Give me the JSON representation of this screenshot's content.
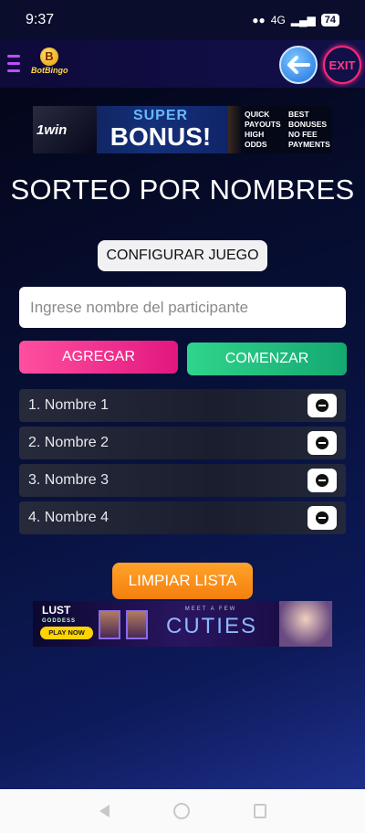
{
  "status_bar": {
    "time": "9:37",
    "network_label": "4G",
    "battery": "74"
  },
  "header": {
    "logo_letter": "B",
    "logo_text": "BotBingo",
    "exit_label": "EXIT"
  },
  "ad_top": {
    "brand": "1win",
    "headline_small": "SUPER",
    "headline_big": "BONUS!",
    "col1": [
      "QUICK",
      "PAYOUTS",
      "HIGH",
      "ODDS"
    ],
    "col2": [
      "BEST",
      "BONUSES",
      "NO FEE",
      "PAYMENTS"
    ]
  },
  "page_title": "SORTEO POR NOMBRES",
  "config_button": "CONFIGURAR JUEGO",
  "name_input": {
    "placeholder": "Ingrese nombre del participante",
    "value": ""
  },
  "add_button": "AGREGAR",
  "start_button": "COMENZAR",
  "participants": [
    "1. Nombre 1",
    "2. Nombre 2",
    "3. Nombre 3",
    "4. Nombre 4"
  ],
  "clear_button": "LIMPIAR LISTA",
  "ad_bottom": {
    "brand": "LUST",
    "brand_sub": "GODDESS",
    "cta": "PLAY NOW",
    "tagline": "MEET A FEW",
    "headline": "CUTIES"
  },
  "colors": {
    "add": "#e2177f",
    "start": "#14a870",
    "clear": "#f57f0e",
    "exit": "#ff2a7a"
  }
}
